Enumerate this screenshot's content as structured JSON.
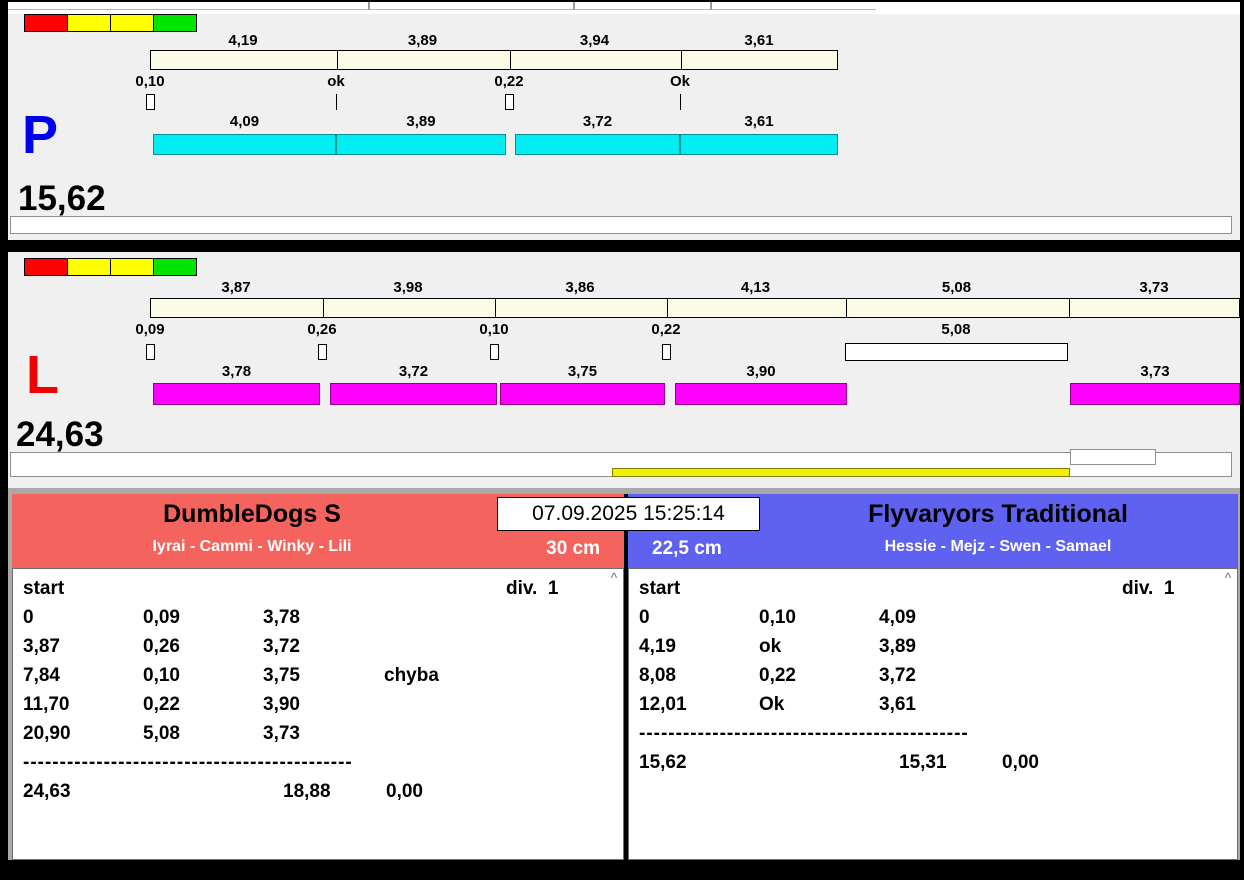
{
  "colors": {
    "lane_p_letter": "#0000f0",
    "lane_l_letter": "#f00000",
    "left_header": "#f4635e",
    "right_header": "#5f61f0",
    "split_bar_top": "#fbfbe6",
    "split_bar_p": "#00eef2",
    "split_bar_l": "#ff00ff",
    "progress_bar": "#f0f000"
  },
  "icons": {
    "scroll_up": "^"
  },
  "lanes": {
    "p": {
      "letter": "P",
      "total": "15,62",
      "top_splits": [
        "4,19",
        "3,89",
        "3,94",
        "3,61"
      ],
      "marks": [
        "0,10",
        "ok",
        "0,22",
        "Ok"
      ],
      "bottom_splits": [
        "4,09",
        "3,89",
        "3,72",
        "3,61"
      ]
    },
    "l": {
      "letter": "L",
      "total": "24,63",
      "top_splits": [
        "3,87",
        "3,98",
        "3,86",
        "4,13",
        "5,08",
        "3,73"
      ],
      "marks": [
        "0,09",
        "0,26",
        "0,10",
        "0,22"
      ],
      "lost_dog_time": "5,08",
      "bottom_splits": [
        "3,78",
        "3,72",
        "3,75",
        "3,90",
        "3,73"
      ]
    }
  },
  "clock": "07.09.2025 15:25:14",
  "teams": {
    "left": {
      "name": "DumbleDogs S",
      "dogs": "Iyrai - Cammi - Winky - Lili",
      "jump_height": "30 cm",
      "table": {
        "start_label": "start",
        "division_label": "div.  1",
        "rows": [
          [
            "0",
            "0,09",
            "3,78",
            ""
          ],
          [
            "3,87",
            "0,26",
            "3,72",
            ""
          ],
          [
            "7,84",
            "0,10",
            "3,75",
            "chyba"
          ],
          [
            "11,70",
            "0,22",
            "3,90",
            ""
          ],
          [
            "20,90",
            "5,08",
            "3,73",
            ""
          ]
        ],
        "separator": "---------------------------------------------",
        "total": [
          "24,63",
          "18,88",
          "0,00"
        ]
      }
    },
    "right": {
      "name": "Flyvaryors Traditional",
      "dogs": "Hessie - Mejz - Swen - Samael",
      "jump_height": "22,5 cm",
      "table": {
        "start_label": "start",
        "division_label": "div.  1",
        "rows": [
          [
            "0",
            "0,10",
            "4,09",
            ""
          ],
          [
            "4,19",
            "ok",
            "3,89",
            ""
          ],
          [
            "8,08",
            "0,22",
            "3,72",
            ""
          ],
          [
            "12,01",
            "Ok",
            "3,61",
            ""
          ]
        ],
        "separator": "---------------------------------------------",
        "total": [
          "15,62",
          "15,31",
          "0,00"
        ]
      }
    }
  }
}
